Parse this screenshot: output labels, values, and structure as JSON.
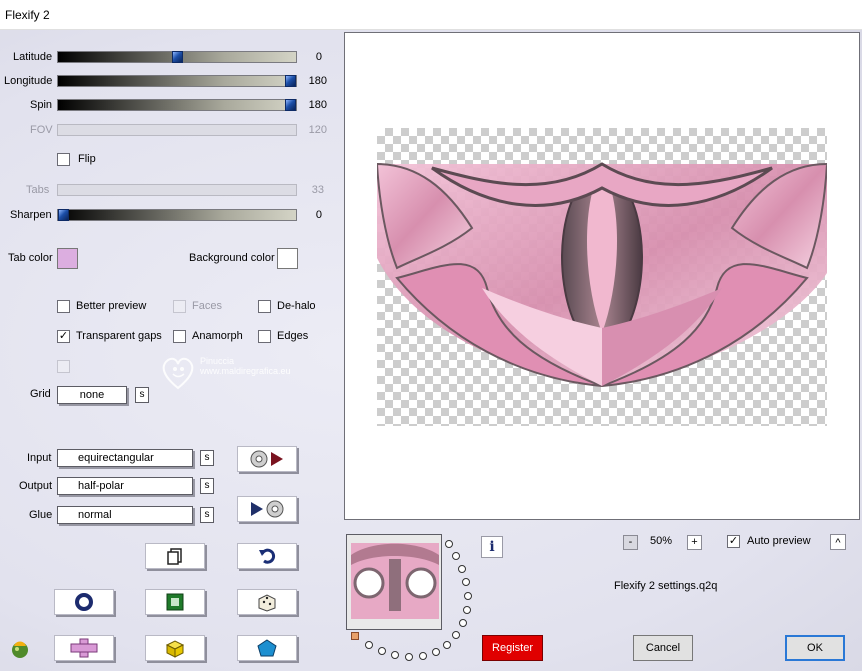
{
  "window": {
    "title": "Flexify 2"
  },
  "sliders": [
    {
      "label": "Latitude",
      "value": "0",
      "fraction": 0.5,
      "enabled": true
    },
    {
      "label": "Longitude",
      "value": "180",
      "fraction": 1.0,
      "enabled": true
    },
    {
      "label": "Spin",
      "value": "180",
      "fraction": 1.0,
      "enabled": true
    },
    {
      "label": "FOV",
      "value": "120",
      "fraction": null,
      "enabled": false
    },
    {
      "label": "Tabs",
      "value": "33",
      "fraction": null,
      "enabled": false
    },
    {
      "label": "Sharpen",
      "value": "0",
      "fraction": 0.0,
      "enabled": true
    }
  ],
  "flip": {
    "label": "Flip",
    "checked": false
  },
  "tab_color": {
    "label": "Tab color",
    "color": "#dcaee0"
  },
  "background_color": {
    "label": "Background color",
    "color": "#ffffff"
  },
  "options": {
    "better_preview": {
      "label": "Better preview",
      "checked": false
    },
    "faces": {
      "label": "Faces",
      "checked": false,
      "enabled": false
    },
    "de_halo": {
      "label": "De-halo",
      "checked": false
    },
    "transparent_gaps": {
      "label": "Transparent gaps",
      "checked": true
    },
    "anamorph": {
      "label": "Anamorph",
      "checked": false
    },
    "edges": {
      "label": "Edges",
      "checked": false
    }
  },
  "grid": {
    "label": "Grid",
    "value": "none",
    "s": "s"
  },
  "input": {
    "label": "Input",
    "value": "equirectangular",
    "s": "s"
  },
  "output": {
    "label": "Output",
    "value": "half-polar",
    "s": "s"
  },
  "glue": {
    "label": "Glue",
    "value": "normal",
    "s": "s"
  },
  "watermark": {
    "name": "Pinuccia",
    "url": "www.maldiregrafica.eu"
  },
  "zoom": {
    "minus": "-",
    "value": "50%",
    "plus": "+"
  },
  "auto_preview": {
    "label": "Auto preview",
    "checked": true,
    "caret": "^"
  },
  "settings_file": "Flexify 2 settings.q2q",
  "info_icon": "i",
  "buttons": {
    "register": "Register",
    "cancel": "Cancel",
    "ok": "OK"
  },
  "colors": {
    "accent_red": "#e00000",
    "preview_pink": "#e8a7c4"
  }
}
